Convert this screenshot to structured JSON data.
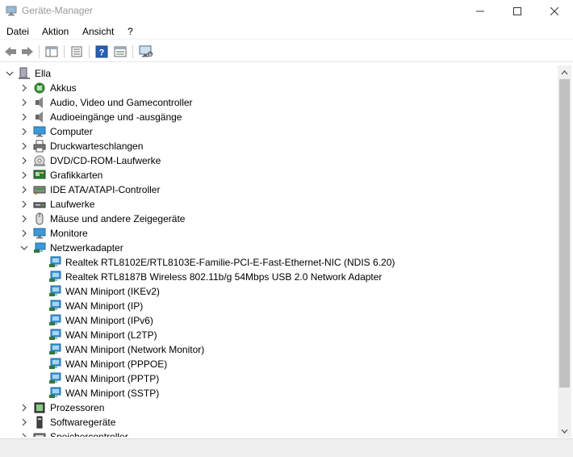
{
  "window": {
    "title": "Geräte-Manager"
  },
  "menu": [
    "Datei",
    "Aktion",
    "Ansicht",
    "?"
  ],
  "toolbar": [
    "back-icon",
    "forward-icon",
    "properties-pane-icon",
    "device-list-icon",
    "help-icon",
    "details-icon",
    "monitor-scan-icon"
  ],
  "tree": {
    "root": "Ella",
    "categories": [
      {
        "label": "Akkus",
        "icon": "battery-icon"
      },
      {
        "label": "Audio, Video und Gamecontroller",
        "icon": "speaker-icon"
      },
      {
        "label": "Audioeingänge und -ausgänge",
        "icon": "speaker-icon"
      },
      {
        "label": "Computer",
        "icon": "computer-icon"
      },
      {
        "label": "Druckwarteschlangen",
        "icon": "printer-icon"
      },
      {
        "label": "DVD/CD-ROM-Laufwerke",
        "icon": "disc-drive-icon"
      },
      {
        "label": "Grafikkarten",
        "icon": "display-adapter-icon"
      },
      {
        "label": "IDE ATA/ATAPI-Controller",
        "icon": "ide-controller-icon"
      },
      {
        "label": "Laufwerke",
        "icon": "disk-drive-icon"
      },
      {
        "label": "Mäuse und andere Zeigegeräte",
        "icon": "mouse-icon"
      },
      {
        "label": "Monitore",
        "icon": "monitor-icon"
      },
      {
        "label": "Netzwerkadapter",
        "icon": "network-adapter-icon",
        "expanded": true,
        "children": [
          "Realtek RTL8102E/RTL8103E-Familie-PCI-E-Fast-Ethernet-NIC (NDIS 6.20)",
          "Realtek RTL8187B Wireless 802.11b/g 54Mbps USB 2.0 Network Adapter",
          "WAN Miniport (IKEv2)",
          "WAN Miniport (IP)",
          "WAN Miniport (IPv6)",
          "WAN Miniport (L2TP)",
          "WAN Miniport (Network Monitor)",
          "WAN Miniport (PPPOE)",
          "WAN Miniport (PPTP)",
          "WAN Miniport (SSTP)"
        ]
      },
      {
        "label": "Prozessoren",
        "icon": "processor-icon"
      },
      {
        "label": "Softwaregeräte",
        "icon": "software-device-icon"
      },
      {
        "label": "Speichercontroller",
        "icon": "storage-controller-icon"
      }
    ]
  }
}
